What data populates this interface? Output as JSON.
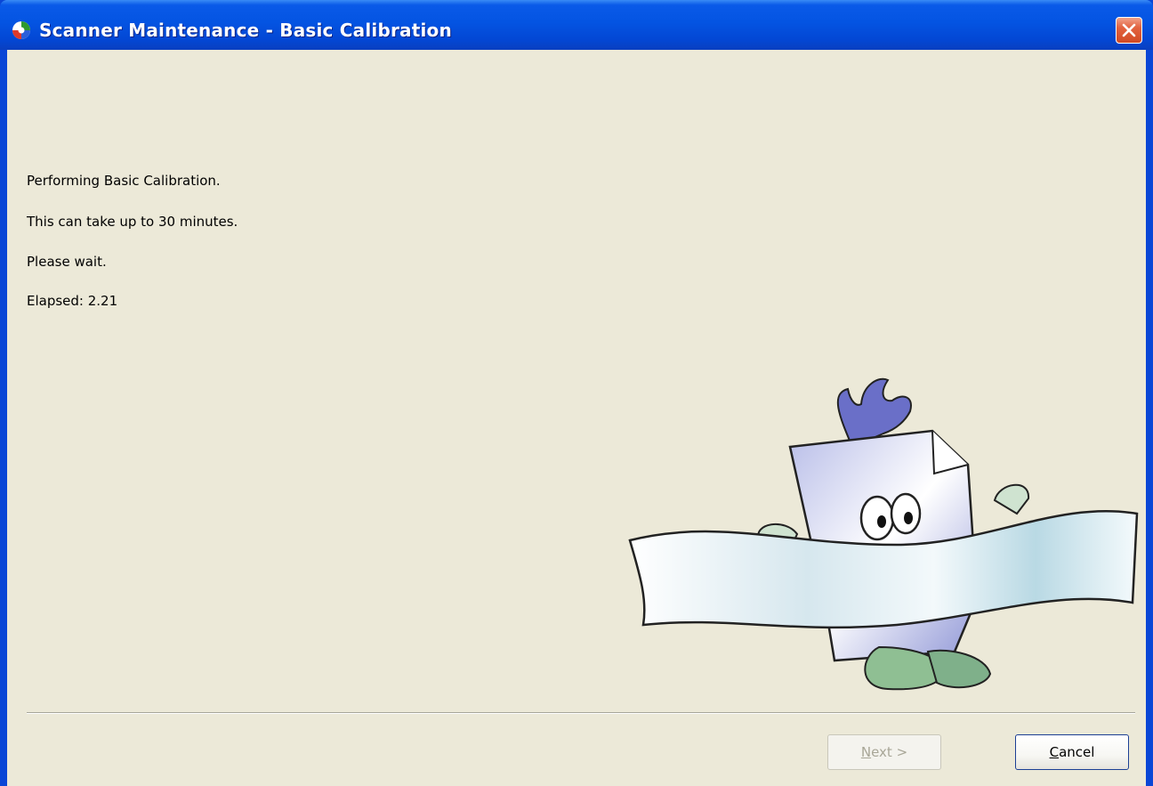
{
  "window": {
    "title": "Scanner Maintenance - Basic Calibration",
    "icon": "scanner-app-icon"
  },
  "messages": {
    "line1": "Performing Basic Calibration.",
    "line2": "This can take up to 30 minutes.",
    "line3": "Please wait.",
    "elapsed": "Elapsed: 2.21"
  },
  "buttons": {
    "next": {
      "mnemonic": "N",
      "rest": "ext >",
      "enabled": false
    },
    "cancel": {
      "mnemonic": "C",
      "rest": "ancel",
      "enabled": true
    }
  },
  "colors": {
    "titlebar": "#0454e2",
    "client_background": "#ece9d8",
    "close_button": "#e2623f"
  }
}
